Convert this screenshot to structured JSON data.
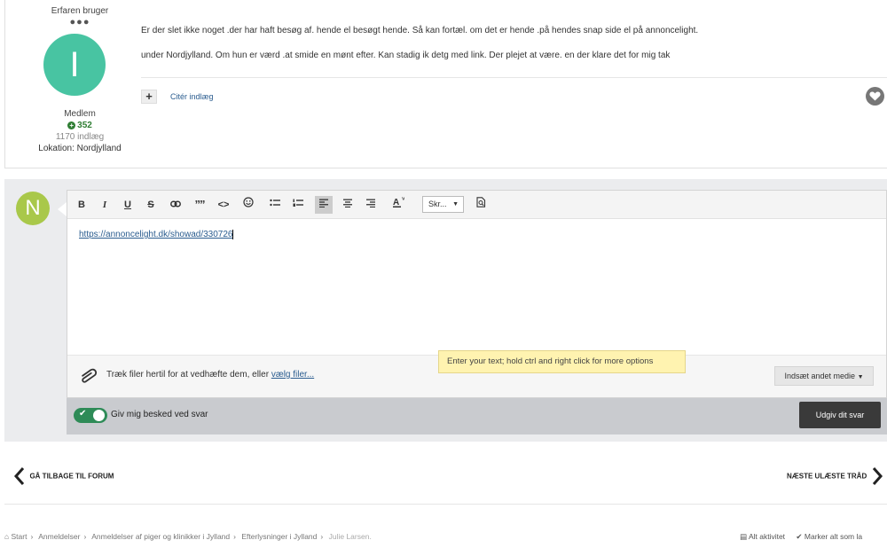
{
  "post": {
    "author": {
      "rank": "Erfaren bruger",
      "rank_pips": "●●●",
      "avatar_letter": "I",
      "avatar_color": "#48c4a2",
      "role": "Medlem",
      "reputation": "352",
      "post_count": "1170 indlæg",
      "location": "Lokation: Nordjylland"
    },
    "body_line_1": "Er der slet ikke noget .der har haft besøg af. hende el besøgt hende. Så kan fortæl. om det er hende .på hendes snap side el på annoncelight.",
    "body_line_2": "under Nordjylland. Om hun er værd .at smide en mønt efter. Kan stadig ik detg med link. Der plejet at være. en der klare det for mig tak",
    "quote_label": "Citér indlæg",
    "like_icon": "heart-icon"
  },
  "reply": {
    "avatar_letter": "N",
    "avatar_color": "#a9c84a",
    "toolbar": {
      "bold": "B",
      "italic": "I",
      "underline": "U",
      "strike": "S",
      "quote": "””",
      "code": "<>",
      "font_select": "Skr..."
    },
    "content_link": "https://annoncelight.dk/showad/330726",
    "attach_text": "Træk filer hertil for at vedhæfte dem, eller",
    "attach_link": "vælg filer...",
    "media_button": "Indsæt andet medie",
    "tooltip": "Enter your text; hold ctrl and right click for more options",
    "notify_label": "Giv mig besked ved svar",
    "notify_on": true,
    "submit_label": "Udgiv dit svar"
  },
  "nav": {
    "back_label": "GÅ TILBAGE TIL FORUM",
    "next_label": "NÆSTE ULÆSTE TRÅD"
  },
  "breadcrumb": {
    "items": [
      "Start",
      "Anmeldelser",
      "Anmeldelser af piger og klinikker i Jylland",
      "Efterlysninger i Jylland"
    ],
    "current": "Julie Larsen."
  },
  "footer": {
    "activity": "Alt aktivitet",
    "mark_read": "Marker alt som la"
  }
}
